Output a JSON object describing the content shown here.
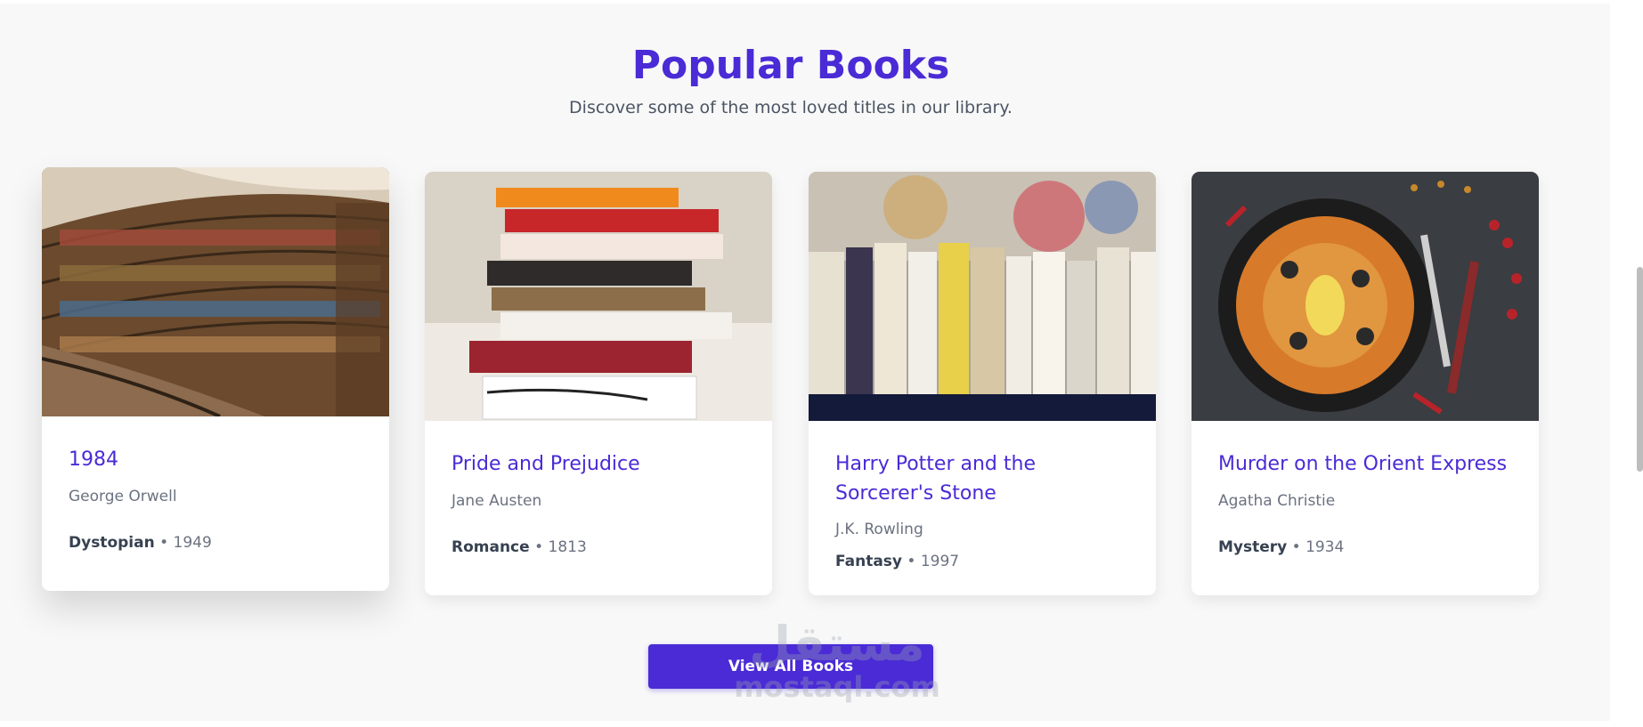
{
  "section": {
    "title": "Popular Books",
    "subtitle": "Discover some of the most loved titles in our library."
  },
  "books": [
    {
      "title": "1984",
      "author": "George Orwell",
      "genre": "Dystopian",
      "year": "1949",
      "image": "library-shelves-image"
    },
    {
      "title": "Pride and Prejudice",
      "author": "Jane Austen",
      "genre": "Romance",
      "year": "1813",
      "image": "stacked-books-image"
    },
    {
      "title": "Harry Potter and the Sorcerer's Stone",
      "author": "J.K. Rowling",
      "genre": "Fantasy",
      "year": "1997",
      "image": "books-row-image"
    },
    {
      "title": "Murder on the Orient Express",
      "author": "Agatha Christie",
      "genre": "Mystery",
      "year": "1934",
      "image": "paella-pan-image"
    }
  ],
  "meta_separator": " • ",
  "view_all_label": "View All Books",
  "watermark": {
    "arabic": "مستقل",
    "latin": "mostaql.com"
  },
  "colors": {
    "accent": "#4a2bd6",
    "background": "#f8f8f8",
    "text_muted": "#6b7280"
  }
}
